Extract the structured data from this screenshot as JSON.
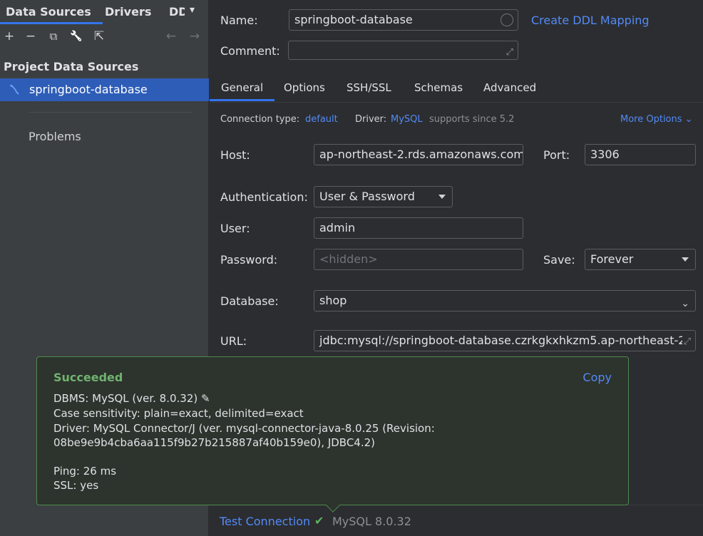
{
  "left": {
    "tabs": [
      "Data Sources",
      "Drivers",
      "DD"
    ],
    "toolbar": {
      "add": "+",
      "remove": "−",
      "copy": "⧉",
      "wrench": "🔧",
      "export": "⇱",
      "back": "←",
      "forward": "→"
    },
    "section_title": "Project Data Sources",
    "datasource": "springboot-database",
    "problems": "Problems"
  },
  "right": {
    "name_label": "Name:",
    "name_value": "springboot-database",
    "create_ddl": "Create DDL Mapping",
    "comment_label": "Comment:",
    "tabs": [
      "General",
      "Options",
      "SSH/SSL",
      "Schemas",
      "Advanced"
    ],
    "conn_type_label": "Connection type:",
    "conn_type_value": "default",
    "driver_label": "Driver:",
    "driver_value": "MySQL",
    "driver_note": "supports since 5.2",
    "more_options": "More Options",
    "host_label": "Host:",
    "host_value": "ap-northeast-2.rds.amazonaws.com",
    "port_label": "Port:",
    "port_value": "3306",
    "auth_label": "Authentication:",
    "auth_value": "User & Password",
    "user_label": "User:",
    "user_value": "admin",
    "password_label": "Password:",
    "password_placeholder": "<hidden>",
    "save_label": "Save:",
    "save_value": "Forever",
    "database_label": "Database:",
    "database_value": "shop",
    "url_label": "URL:",
    "url_value": "jdbc:mysql://springboot-database.czrkgkxhkzm5.ap-northeast-2",
    "test_connection": "Test Connection",
    "test_result": "MySQL 8.0.32"
  },
  "popup": {
    "title": "Succeeded",
    "copy": "Copy",
    "dbms": "DBMS: MySQL (ver. 8.0.32)",
    "case": "Case sensitivity: plain=exact, delimited=exact",
    "driver1": "Driver: MySQL Connector/J (ver. mysql-connector-java-8.0.25 (Revision:",
    "driver2": "08be9e9b4cba6aa115f9b27b215887af40b159e0), JDBC4.2)",
    "ping": "Ping: 26 ms",
    "ssl": "SSL: yes"
  },
  "colors": {
    "accent": "#3574f0",
    "link": "#548af7",
    "success": "#6fb36f",
    "selection": "#2e5db8"
  }
}
